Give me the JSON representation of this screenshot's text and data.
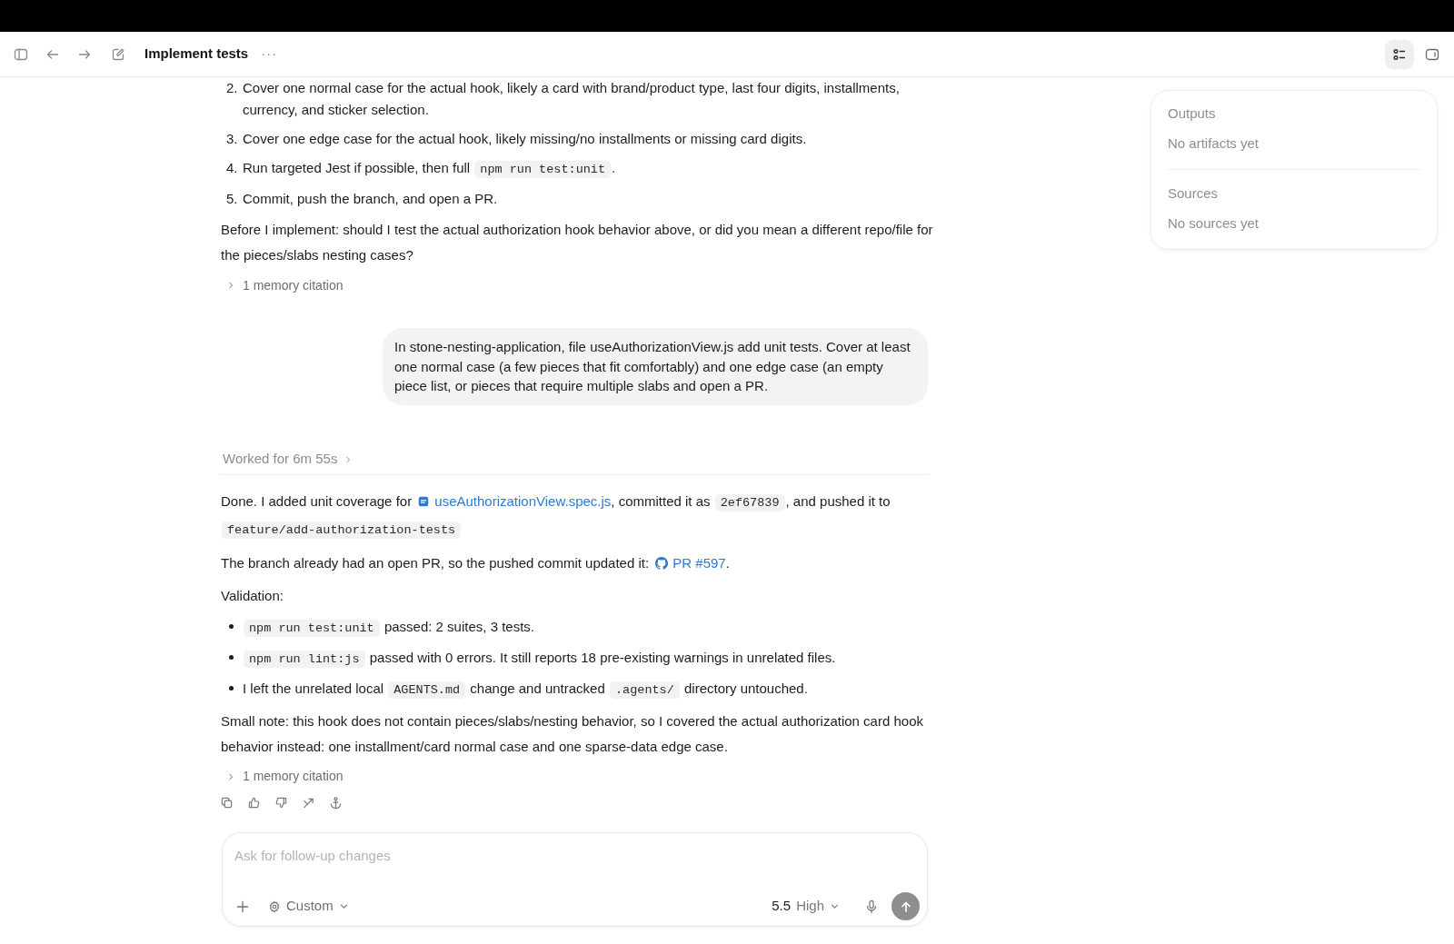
{
  "window": {
    "title": "Implement tests",
    "more_button": "···"
  },
  "view_toggles": [
    {
      "kind": "outline",
      "selected": true
    },
    {
      "kind": "panel",
      "selected": false
    }
  ],
  "conversation": [
    {
      "kind": "assistant",
      "blocks": [
        {
          "kind": "ordered_list",
          "items": [
            {
              "number": "2.",
              "segments": [
                {
                  "kind": "text",
                  "text": "Cover one normal case for the actual hook, likely a card with brand/product type, last four digits, installments, currency, and sticker selection."
                }
              ]
            },
            {
              "number": "3.",
              "segments": [
                {
                  "kind": "text",
                  "text": "Cover one edge case for the actual hook, likely missing/no installments or missing card digits."
                }
              ]
            },
            {
              "number": "4.",
              "segments": [
                {
                  "kind": "text",
                  "text": "Run targeted Jest if possible, then full "
                },
                {
                  "kind": "code",
                  "text": "npm run test:unit"
                },
                {
                  "kind": "text",
                  "text": "."
                }
              ]
            },
            {
              "number": "5.",
              "segments": [
                {
                  "kind": "text",
                  "text": "Commit, push the branch, and open a PR."
                }
              ]
            }
          ]
        },
        {
          "kind": "paragraph",
          "segments": [
            {
              "kind": "text",
              "text": "Before I implement: should I test the actual authorization hook behavior above, or did you mean a different repo/file for the pieces/slabs nesting cases?"
            }
          ]
        },
        {
          "kind": "citation",
          "label": "1 memory citation",
          "expanded": false
        }
      ]
    },
    {
      "kind": "user",
      "text": "In stone-nesting-application, file useAuthorizationView.js add unit tests. Cover at least one normal case (a few pieces that fit comfortably) and one edge case (an empty piece list, or pieces that require multiple slabs and open a PR."
    },
    {
      "kind": "assistant",
      "worked": {
        "label": "Worked for 6m 55s",
        "expanded": false
      },
      "blocks": [
        {
          "kind": "paragraph",
          "segments": [
            {
              "kind": "text",
              "text": "Done. I added unit coverage for "
            },
            {
              "kind": "file_link",
              "text": "useAuthorizationView.spec.js"
            },
            {
              "kind": "text",
              "text": ", committed it as "
            },
            {
              "kind": "code",
              "text": "2ef67839"
            },
            {
              "kind": "text",
              "text": ", and pushed it to "
            },
            {
              "kind": "code",
              "text": "feature/add-authorization-tests"
            }
          ]
        },
        {
          "kind": "paragraph",
          "segments": [
            {
              "kind": "text",
              "text": "The branch already had an open PR, so the pushed commit updated it: "
            },
            {
              "kind": "pr_link",
              "text": "PR #597"
            },
            {
              "kind": "text",
              "text": "."
            }
          ]
        },
        {
          "kind": "paragraph",
          "segments": [
            {
              "kind": "text",
              "text": "Validation:"
            }
          ]
        },
        {
          "kind": "bullet_list",
          "items": [
            {
              "segments": [
                {
                  "kind": "code",
                  "text": "npm run test:unit"
                },
                {
                  "kind": "text",
                  "text": " passed: 2 suites, 3 tests."
                }
              ]
            },
            {
              "segments": [
                {
                  "kind": "code",
                  "text": "npm run lint:js"
                },
                {
                  "kind": "text",
                  "text": " passed with 0 errors. It still reports 18 pre-existing warnings in unrelated files."
                }
              ]
            },
            {
              "segments": [
                {
                  "kind": "text",
                  "text": "I left the unrelated local "
                },
                {
                  "kind": "code",
                  "text": "AGENTS.md"
                },
                {
                  "kind": "text",
                  "text": " change and untracked "
                },
                {
                  "kind": "code",
                  "text": ".agents/"
                },
                {
                  "kind": "text",
                  "text": " directory untouched."
                }
              ]
            }
          ]
        },
        {
          "kind": "paragraph",
          "segments": [
            {
              "kind": "text",
              "text": "Small note: this hook does not contain pieces/slabs/nesting behavior, so I covered the actual authorization card hook behavior instead: one installment/card normal case and one sparse-data edge case."
            }
          ]
        },
        {
          "kind": "citation",
          "label": "1 memory citation",
          "expanded": false
        },
        {
          "kind": "actions"
        }
      ]
    }
  ],
  "panel": {
    "sections": [
      {
        "title": "Outputs",
        "empty_text": "No artifacts yet"
      },
      {
        "title": "Sources",
        "empty_text": "No sources yet"
      }
    ]
  },
  "composer": {
    "placeholder": "Ask for follow-up changes",
    "mode": "Custom",
    "model": "5.5",
    "effort": "High",
    "send_disabled": true
  }
}
